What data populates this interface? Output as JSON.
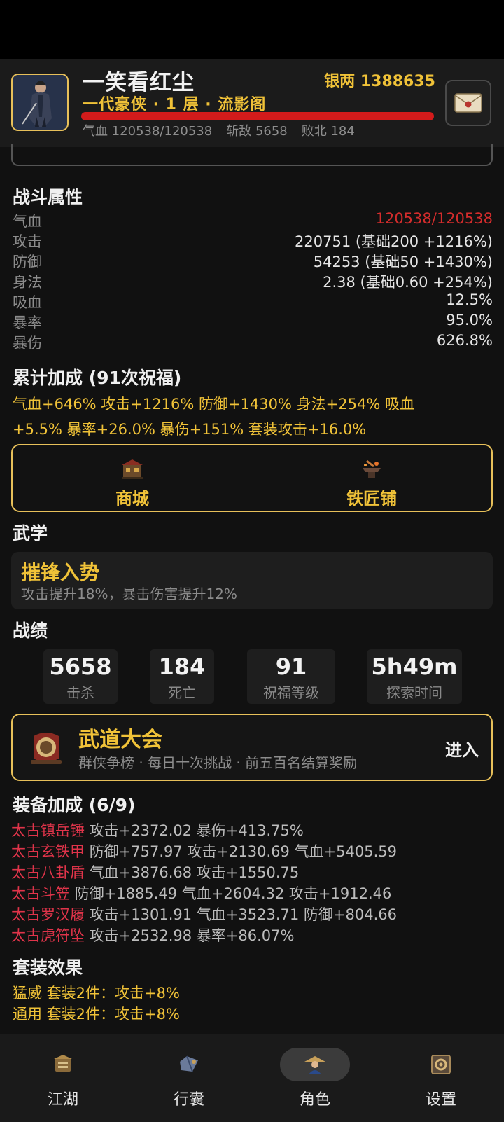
{
  "header": {
    "name": "一笑看红尘",
    "silver": "银两 1388635",
    "rank": "一代豪侠 · 1 层 · 流影阁",
    "hp": "气血 120538/120538",
    "kills": "斩敌 5658",
    "defeats": "败北 184"
  },
  "combat": {
    "title": "战斗属性",
    "rows": [
      {
        "label": "气血",
        "value": "120538/120538"
      },
      {
        "label": "攻击",
        "value": "220751 (基础200 +1216%)"
      },
      {
        "label": "防御",
        "value": "54253 (基础50 +1430%)"
      },
      {
        "label": "身法",
        "value": "2.38 (基础0.60 +254%)"
      },
      {
        "label": "吸血",
        "value": "12.5%"
      },
      {
        "label": "暴率",
        "value": "95.0%"
      },
      {
        "label": "暴伤",
        "value": "626.8%"
      }
    ]
  },
  "bonus": {
    "title": "累计加成 (91次祝福)",
    "line1": "气血+646% 攻击+1216% 防御+1430% 身法+254% 吸血",
    "line2": "+5.5% 暴率+26.0% 暴伤+151% 套装攻击+16.0%"
  },
  "shops": {
    "mall": "商城",
    "smith": "铁匠铺"
  },
  "martial": {
    "title": "武学",
    "skill_name": "摧锋入势",
    "skill_desc": "攻击提升18%，暴击伤害提升12%"
  },
  "records": {
    "title": "战绩",
    "items": [
      {
        "value": "5658",
        "label": "击杀"
      },
      {
        "value": "184",
        "label": "死亡"
      },
      {
        "value": "91",
        "label": "祝福等级"
      },
      {
        "value": "5h49m",
        "label": "探索时间"
      }
    ]
  },
  "arena": {
    "title": "武道大会",
    "desc": "群侠争榜 · 每日十次挑战 · 前五百名结算奖励",
    "enter": "进入"
  },
  "equipment": {
    "title": "装备加成 (6/9)",
    "items": [
      {
        "name": "太古镇岳锤",
        "stats": "攻击+2372.02 暴伤+413.75%"
      },
      {
        "name": "太古玄铁甲",
        "stats": "防御+757.97 攻击+2130.69 气血+5405.59"
      },
      {
        "name": "太古八卦盾",
        "stats": "气血+3876.68 攻击+1550.75"
      },
      {
        "name": "太古斗笠",
        "stats": "防御+1885.49 气血+2604.32 攻击+1912.46"
      },
      {
        "name": "太古罗汉履",
        "stats": "攻击+1301.91 气血+3523.71 防御+804.66"
      },
      {
        "name": "太古虎符坠",
        "stats": "攻击+2532.98 暴率+86.07%"
      }
    ]
  },
  "sets": {
    "title": "套装效果",
    "items": [
      "猛威 套装2件：攻击+8%",
      "通用 套装2件：攻击+8%"
    ]
  },
  "nav": {
    "items": [
      {
        "label": "江湖",
        "icon": "jianghu-icon"
      },
      {
        "label": "行囊",
        "icon": "bag-icon"
      },
      {
        "label": "角色",
        "icon": "character-icon",
        "active": true
      },
      {
        "label": "设置",
        "icon": "settings-icon"
      }
    ]
  },
  "colors": {
    "gold": "#f0c238",
    "red": "#e0344a",
    "hp_red": "#d31b1b"
  }
}
